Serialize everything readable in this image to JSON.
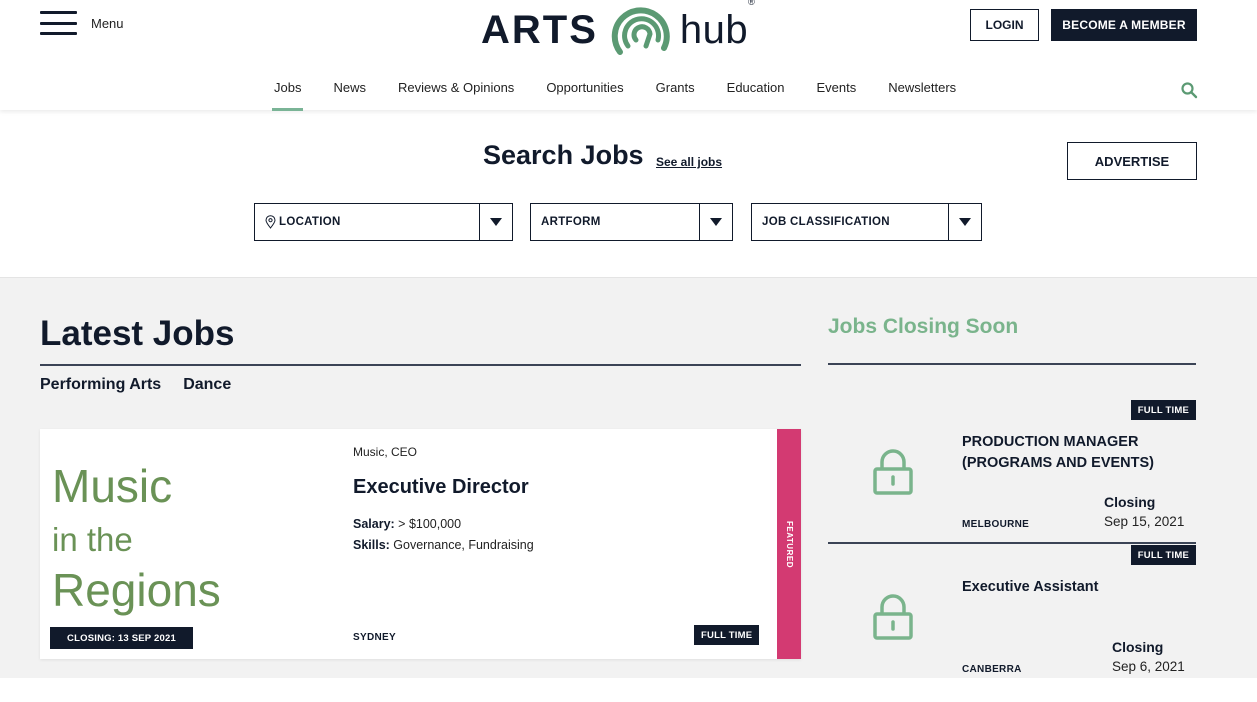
{
  "header": {
    "menu_label": "Menu",
    "logo_left": "ARTS",
    "logo_right": "hub",
    "logo_reg": "®",
    "login_label": "LOGIN",
    "member_label": "BECOME A MEMBER"
  },
  "nav": {
    "items": [
      "Jobs",
      "News",
      "Reviews & Opinions",
      "Opportunities",
      "Grants",
      "Education",
      "Events",
      "Newsletters"
    ],
    "active": "Jobs"
  },
  "search": {
    "title": "Search Jobs",
    "see_all": "See all jobs",
    "advertise": "ADVERTISE",
    "filters": {
      "location": "LOCATION",
      "artform": "ARTFORM",
      "classification": "JOB CLASSIFICATION"
    }
  },
  "latest": {
    "title": "Latest Jobs",
    "filters": [
      "Performing Arts",
      "Dance"
    ],
    "job": {
      "image_line1": "Music",
      "image_line2": "in the",
      "image_line3": "Regions",
      "closing_badge": "CLOSING: 13 SEP 2021",
      "categories": "Music, CEO",
      "title": "Executive Director",
      "salary_label": "Salary:",
      "salary_value": " > $100,000",
      "skills_label": "Skills:",
      "skills_value": " Governance, Fundraising",
      "location": "SYDNEY",
      "type": "FULL TIME",
      "featured": "FEATURED"
    }
  },
  "closing_soon": {
    "title": "Jobs Closing Soon",
    "items": [
      {
        "type": "FULL TIME",
        "title": "PRODUCTION MANAGER (PROGRAMS AND EVENTS)",
        "closing_label": "Closing",
        "closing_date": "Sep 15, 2021",
        "city": "MELBOURNE"
      },
      {
        "type": "FULL TIME",
        "title": "Executive Assistant",
        "closing_label": "Closing",
        "closing_date": "Sep 6, 2021",
        "city": "CANBERRA"
      }
    ]
  },
  "colors": {
    "navy": "#111a2b",
    "green": "#7ab48c",
    "logo_green": "#5b9a73",
    "featured_pink": "#d33a72",
    "panel_gray": "#f2f2f2"
  },
  "icons": [
    "hamburger-icon",
    "logo-swirl-icon",
    "search-icon",
    "location-pin-icon",
    "chevron-down-icon",
    "lock-icon"
  ]
}
